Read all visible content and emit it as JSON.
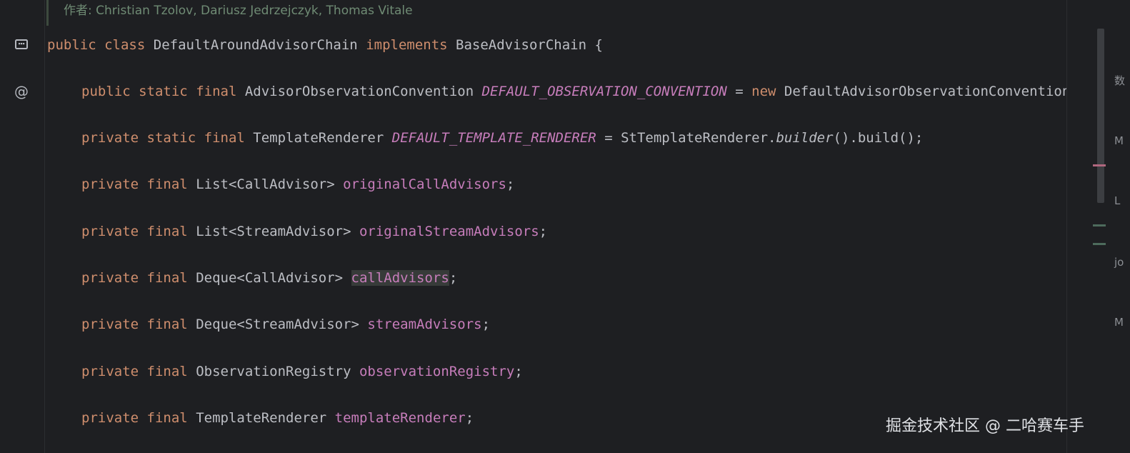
{
  "doc_comment": {
    "author_line": "作者: Christian Tzolov, Dariusz Jedrzejczyk, Thomas Vitale"
  },
  "gutter": {
    "icons": [
      "class-structure-icon",
      "at-sign-icon"
    ],
    "at_glyph": "@"
  },
  "code": {
    "line1": {
      "kw1": "public",
      "kw2": "class",
      "class_name": "DefaultAroundAdvisorChain",
      "kw3": "implements",
      "iface": "BaseAdvisorChain",
      "brace": "{"
    },
    "line2": {
      "kw1": "public",
      "kw2": "static",
      "kw3": "final",
      "type": "AdvisorObservationConvention",
      "name": "DEFAULT_OBSERVATION_CONVENTION",
      "eq": "=",
      "kw4": "new",
      "rhs": "DefaultAdvisorObservationConvention"
    },
    "line3": {
      "kw1": "private",
      "kw2": "static",
      "kw3": "final",
      "type": "TemplateRenderer",
      "name": "DEFAULT_TEMPLATE_RENDERER",
      "eq": "=",
      "rhs_class": "StTemplateRenderer.",
      "rhs_method": "builder",
      "rhs_tail": "().build();"
    },
    "line4": {
      "kw1": "private",
      "kw2": "final",
      "type": "List<CallAdvisor>",
      "name": "originalCallAdvisors",
      "end": ";"
    },
    "line5": {
      "kw1": "private",
      "kw2": "final",
      "type": "List<StreamAdvisor>",
      "name": "originalStreamAdvisors",
      "end": ";"
    },
    "line6": {
      "kw1": "private",
      "kw2": "final",
      "type": "Deque<CallAdvisor>",
      "name": "callAdvisors",
      "end": ";"
    },
    "line7": {
      "kw1": "private",
      "kw2": "final",
      "type": "Deque<StreamAdvisor>",
      "name": "streamAdvisors",
      "end": ";"
    },
    "line8": {
      "kw1": "private",
      "kw2": "final",
      "type": "ObservationRegistry",
      "name": "observationRegistry",
      "end": ";"
    },
    "line9": {
      "kw1": "private",
      "kw2": "final",
      "type": "TemplateRenderer",
      "name": "templateRenderer",
      "end": ";"
    }
  },
  "side_panel": {
    "fragments": [
      "数",
      "M",
      "L",
      "jo",
      "M"
    ]
  },
  "watermark": "掘金技术社区 @ 二哈赛车手",
  "colors": {
    "background": "#1e1f22",
    "keyword": "#cf8e6d",
    "field": "#c77dbb",
    "plain": "#bcbec4",
    "doc_comment": "#6f8b74"
  }
}
